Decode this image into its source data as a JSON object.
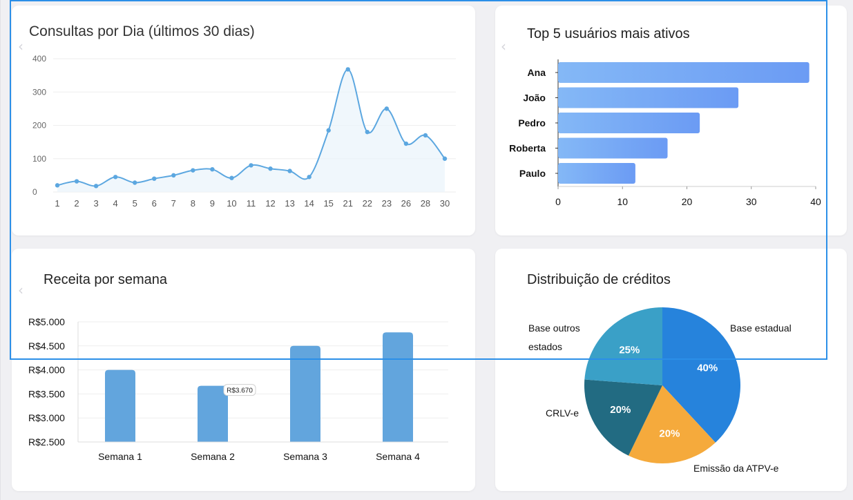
{
  "charts": {
    "daily": {
      "title": "Consultas por Dia (últimos 30 dias)",
      "chart_data": {
        "type": "area",
        "title": "Consultas por Dia (últimos 30 dias)",
        "categories": [
          "1",
          "2",
          "3",
          "4",
          "5",
          "6",
          "7",
          "8",
          "9",
          "10",
          "11",
          "12",
          "13",
          "14",
          "15",
          "21",
          "22",
          "23",
          "26",
          "28",
          "30"
        ],
        "values": [
          20,
          32,
          18,
          45,
          28,
          40,
          50,
          65,
          68,
          42,
          80,
          70,
          63,
          45,
          185,
          368,
          180,
          250,
          145,
          170,
          100
        ],
        "ylim": [
          0,
          400
        ],
        "yticks": [
          0,
          100,
          200,
          300,
          400
        ],
        "grid": true,
        "color": "#5ca7e0"
      }
    },
    "users": {
      "title": "Top 5 usuários mais ativos",
      "chart_data": {
        "type": "bar",
        "orientation": "horizontal",
        "title": "Top 5 usuários mais ativos",
        "categories": [
          "Ana",
          "João",
          "Pedro",
          "Roberta",
          "Paulo"
        ],
        "values": [
          39,
          28,
          22,
          17,
          12
        ],
        "xlim": [
          0,
          40
        ],
        "xticks": [
          0,
          10,
          20,
          30,
          40
        ],
        "color_start": "#84b8f6",
        "color_end": "#6b9bf4"
      }
    },
    "revenue": {
      "title": "Receita por semana",
      "chart_data": {
        "type": "bar",
        "title": "Receita por semana",
        "categories": [
          "Semana 1",
          "Semana 2",
          "Semana 3",
          "Semana 4"
        ],
        "values": [
          4000,
          3670,
          4500,
          4780
        ],
        "ylim": [
          2500,
          5000
        ],
        "yticks": [
          "R$2.500",
          "R$3.000",
          "R$3.500",
          "R$4.000",
          "R$4.500",
          "R$5.000"
        ],
        "tooltip": "R$3.670",
        "color": "#62a5dd"
      }
    },
    "credits": {
      "title": "Distribuição de créditos",
      "chart_data": {
        "type": "pie",
        "title": "Distribuição de créditos",
        "slices": [
          {
            "label": "Base estadual",
            "value": 40,
            "pct": "40%",
            "color": "#2683dc"
          },
          {
            "label": "Emissão da ATPV-e",
            "value": 20,
            "pct": "20%",
            "color": "#f5aa3c"
          },
          {
            "label": "CRLV-e",
            "value": 20,
            "pct": "20%",
            "color": "#226b82"
          },
          {
            "label": "Base outros\nestados",
            "value": 25,
            "pct": "25%",
            "color": "#3aa0c7"
          }
        ]
      }
    }
  }
}
